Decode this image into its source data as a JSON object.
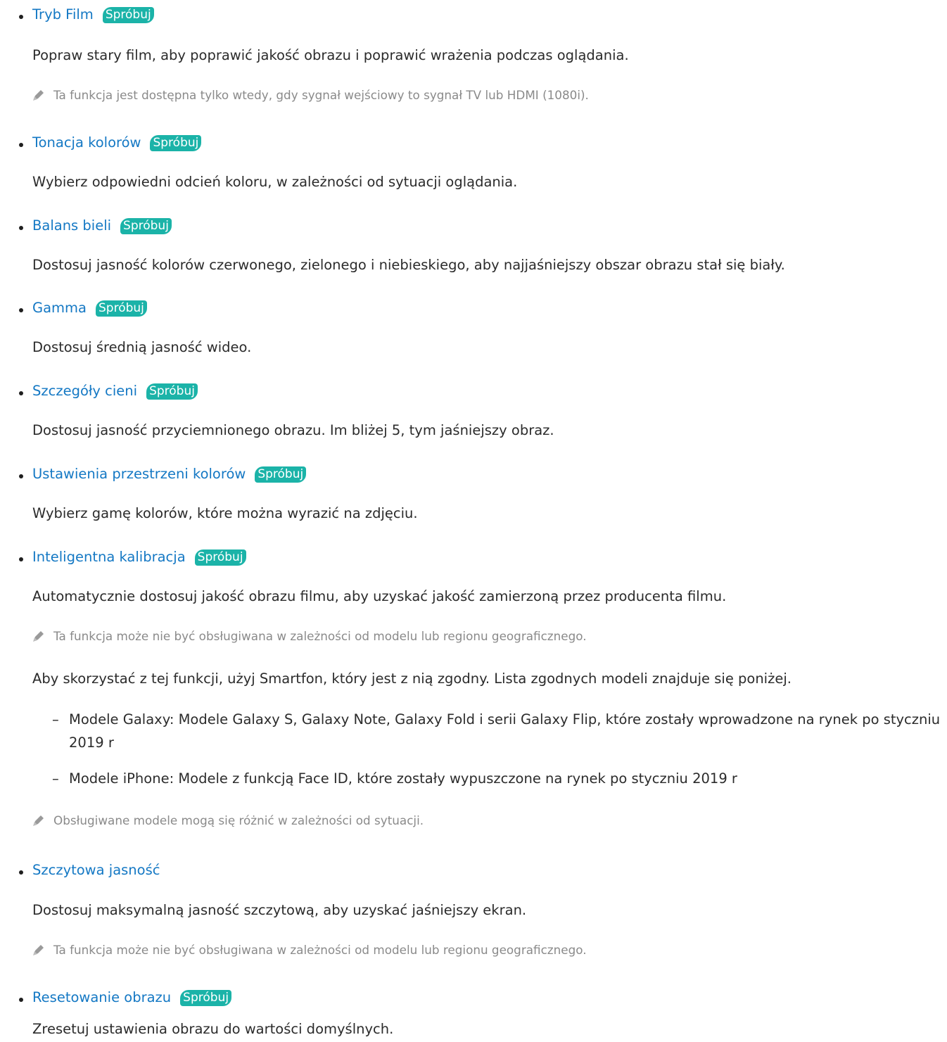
{
  "try_label": "Spróbuj",
  "items": [
    {
      "title": "Tryb Film",
      "description": "Popraw stary film, aby poprawić jakość obrazu i poprawić wrażenia podczas oglądania.",
      "note": "Ta funkcja jest dostępna tylko wtedy, gdy sygnał wejściowy to sygnał TV lub HDMI (1080i)."
    },
    {
      "title": "Tonacja kolorów",
      "description": "Wybierz odpowiedni odcień koloru, w zależności od sytuacji oglądania."
    },
    {
      "title": "Balans bieli",
      "description": "Dostosuj jasność kolorów czerwonego, zielonego i niebieskiego, aby najjaśniejszy obszar obrazu stał się biały."
    },
    {
      "title": "Gamma",
      "description": "Dostosuj średnią jasność wideo."
    },
    {
      "title": "Szczegóły cieni",
      "description": "Dostosuj jasność przyciemnionego obrazu. Im bliżej 5, tym jaśniejszy obraz."
    },
    {
      "title": "Ustawienia przestrzeni kolorów",
      "description": "Wybierz gamę kolorów, które można wyrazić na zdjęciu."
    },
    {
      "title": "Inteligentna kalibracja",
      "description": "Automatycznie dostosuj jakość obrazu filmu, aby uzyskać jakość zamierzoną przez producenta filmu.",
      "note": "Ta funkcja może nie być obsługiwana w zależności od modelu lub regionu geograficznego.",
      "extra": "Aby skorzystać z tej funkcji, użyj Smartfon, który jest z nią zgodny. Lista zgodnych modeli znajduje się poniżej.",
      "sublist": [
        "Modele Galaxy: Modele Galaxy S, Galaxy Note, Galaxy Fold i serii Galaxy Flip, które zostały wprowadzone na rynek po styczniu 2019 r",
        "Modele iPhone: Modele z funkcją Face ID, które zostały wypuszczone na rynek po styczniu 2019 r"
      ],
      "note2": "Obsługiwane modele mogą się różnić w zależności od sytuacji."
    },
    {
      "title": "Szczytowa jasność",
      "description": "Dostosuj maksymalną jasność szczytową, aby uzyskać jaśniejszy ekran.",
      "note": "Ta funkcja może nie być obsługiwana w zależności od modelu lub regionu geograficznego."
    },
    {
      "title": "Resetowanie obrazu",
      "description": "Zresetuj ustawienia obrazu do wartości domyślnych."
    }
  ],
  "colors": {
    "link": "#1478c4",
    "try_badge": "#1bb3a8",
    "body_text": "#2b2b2b",
    "note_text": "#8a8a8a"
  }
}
